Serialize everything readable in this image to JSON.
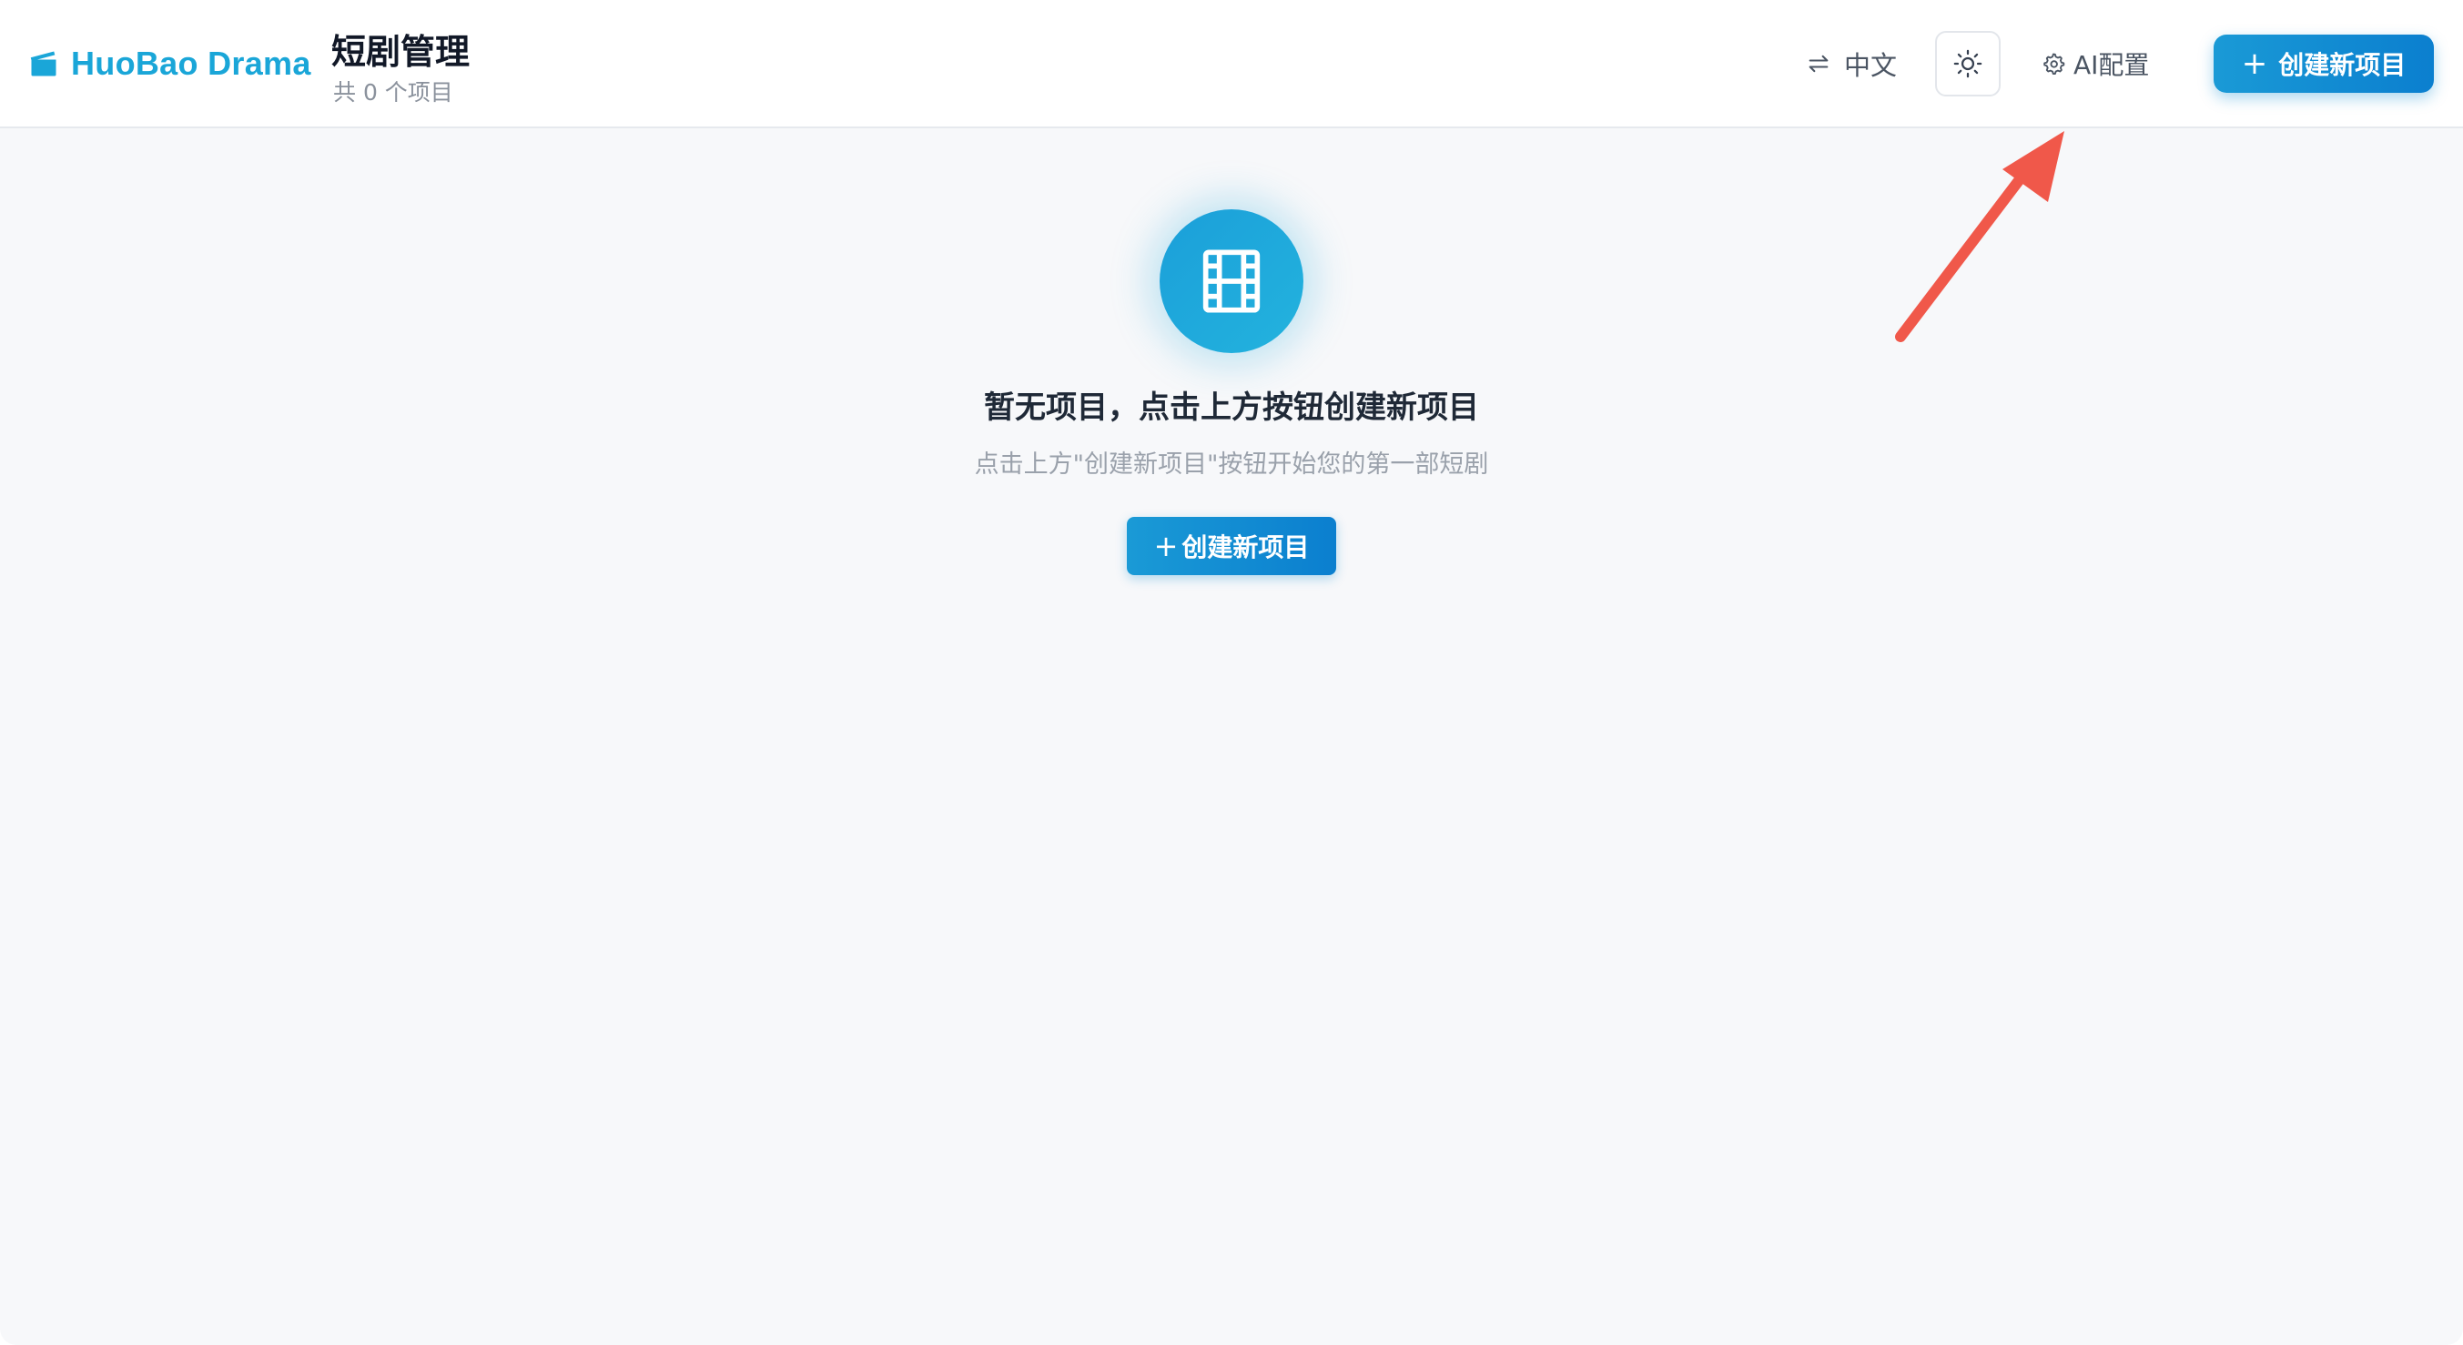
{
  "header": {
    "brand_name": "HuoBao Drama",
    "title": "短剧管理",
    "subtitle": "共 0 个项目",
    "language_label": "中文",
    "ai_config_label": "AI配置",
    "create_button_label": "创建新项目",
    "icons": [
      "clapperboard-icon",
      "language-switch-icon",
      "sun-icon",
      "gear-icon",
      "plus-icon"
    ]
  },
  "empty_state": {
    "icon": "film-icon",
    "title": "暂无项目，点击上方按钮创建新项目",
    "description": "点击上方\"创建新项目\"按钮开始您的第一部短剧",
    "create_button_label": "创建新项目"
  },
  "annotation": {
    "arrow_color": "#f0584a"
  },
  "colors": {
    "brand": "#1aa6d8",
    "primary_button": "#1a9ad6",
    "background": "#f7f8fa"
  }
}
